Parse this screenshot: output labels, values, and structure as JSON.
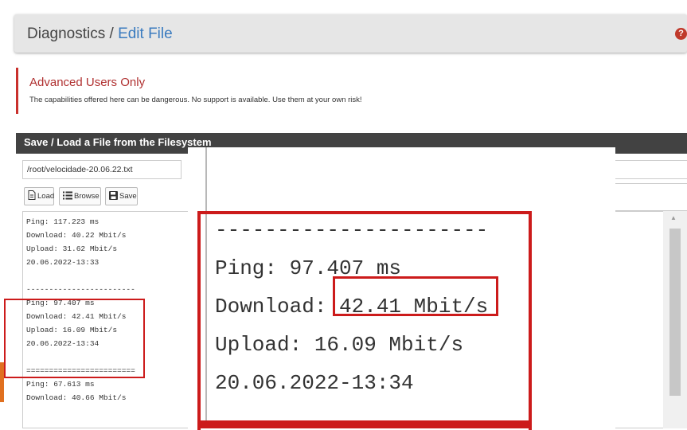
{
  "breadcrumb": {
    "parent": "Diagnostics",
    "separator": "/",
    "current": "Edit File"
  },
  "help_icon": "question-circle-icon",
  "alert": {
    "title": "Advanced Users Only",
    "body": "The capabilities offered here can be dangerous. No support is available. Use them at your own risk!"
  },
  "panel": {
    "title": "Save / Load a File from the Filesystem",
    "path_value": "/root/velocidade-20.06.22.txt",
    "buttons": {
      "load": "Load",
      "browse": "Browse",
      "save": "Save"
    }
  },
  "editor": {
    "content": "Ping: 117.223 ms\nDownload: 40.22 Mbit/s\nUpload: 31.62 Mbit/s\n20.06.2022-13:33\n\n------------------------\nPing: 97.407 ms\nDownload: 42.41 Mbit/s\nUpload: 16.09 Mbit/s\n20.06.2022-13:34\n\n========================\nPing: 67.613 ms\nDownload: 40.66 Mbit/s"
  },
  "zoom": {
    "content": "----------------------\nPing: 97.407 ms\nDownload: 42.41 Mbit/s\nUpload: 16.09 Mbit/s\n20.06.2022-13:34"
  },
  "colors": {
    "accent_link": "#3a7bbf",
    "alert_red": "#c9302c",
    "highlight_red": "#cc1b1b",
    "panel_header": "#424242"
  }
}
